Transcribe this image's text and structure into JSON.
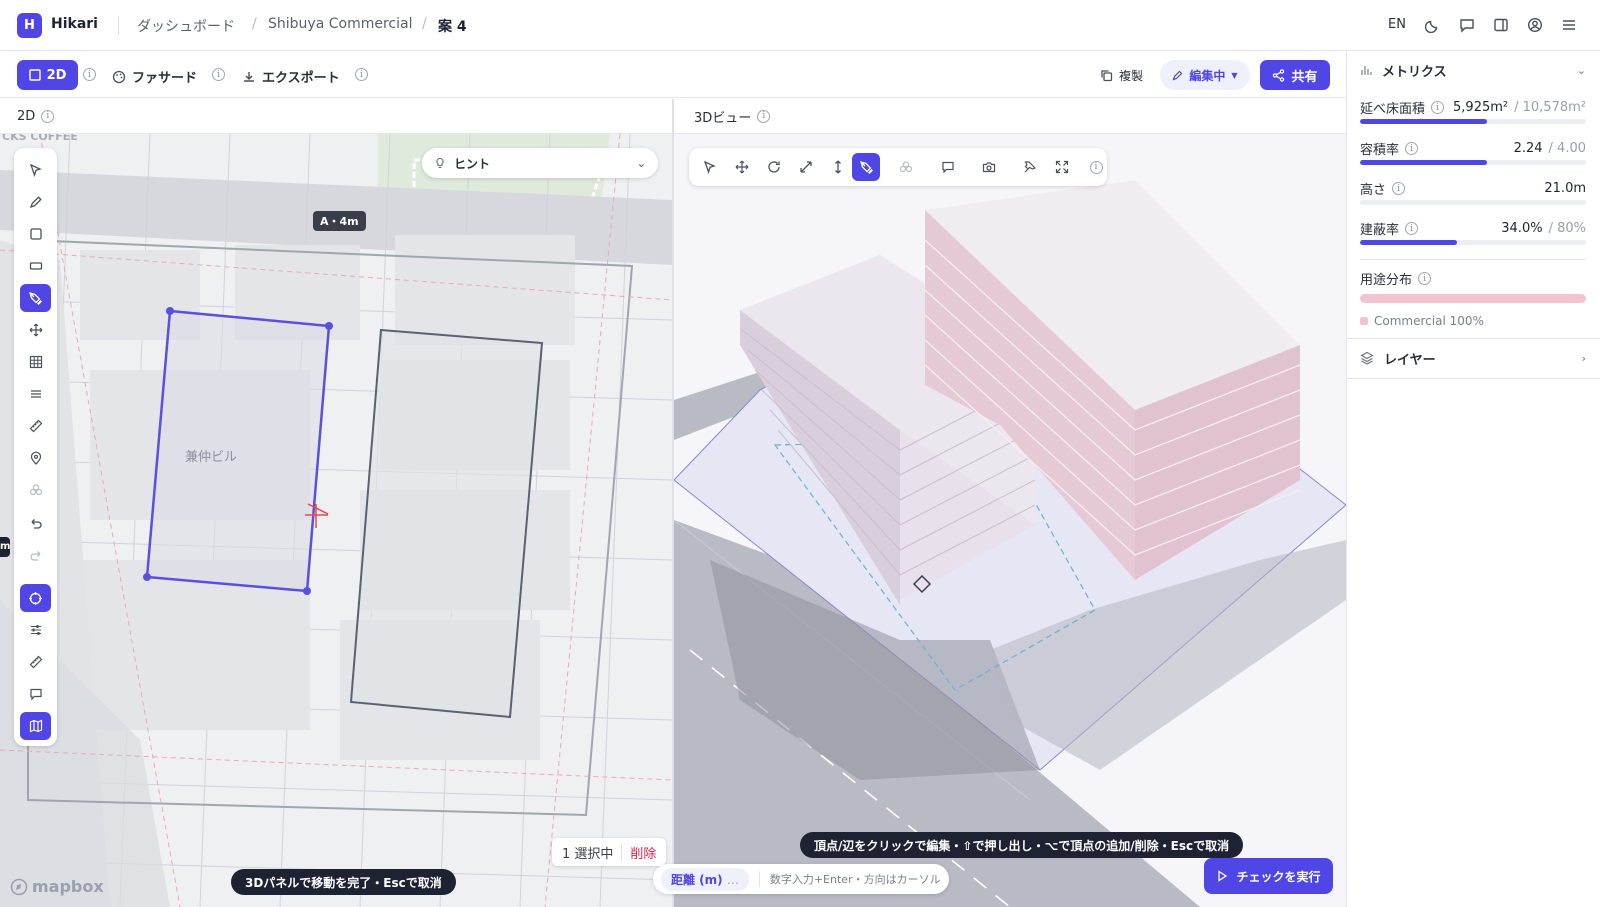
{
  "header": {
    "logo_letter": "H",
    "app_name": "Hikari",
    "breadcrumb": [
      "ダッシュボード",
      "Shibuya Commercial",
      "案 4"
    ],
    "lang": "EN"
  },
  "toolbar": {
    "mode_2d": "2D",
    "facade": "ファサード",
    "export": "エクスポート",
    "duplicate": "複製",
    "editing": "編集中",
    "share": "共有"
  },
  "panel_2d": {
    "title": "2D",
    "hint": "ヒント",
    "road_label": "A・4m",
    "building_label": "兼仲ビル",
    "shop_label": "CKS COFFEE",
    "selection_count": "1 選択中",
    "delete": "削除",
    "status": "3Dパネルで移動を完了・Escで取消",
    "mapbox": "mapbox"
  },
  "panel_3d": {
    "title": "3Dビュー",
    "instruction": "頂点/辺をクリックで編集・⇧で押し出し・⌥で頂点の追加/削除・Escで取消",
    "distance_label": "距離 (m)",
    "distance_ellipsis": "…",
    "distance_placeholder": "数字入力+Enter・方向はカーソル",
    "run_check": "チェックを実行"
  },
  "metrics": {
    "title": "メトリクス",
    "rows": [
      {
        "label": "延べ床面積",
        "value": "5,925m²",
        "limit": "/ 10,578m²",
        "fill": 0.56
      },
      {
        "label": "容積率",
        "value": "2.24",
        "limit": "/ 4.00",
        "fill": 0.56
      },
      {
        "label": "高さ",
        "value": "21.0m",
        "limit": "",
        "fill": 0
      },
      {
        "label": "建蔽率",
        "value": "34.0%",
        "limit": "/ 80%",
        "fill": 0.43
      }
    ],
    "usage_title": "用途分布",
    "usage_legend": "Commercial 100%",
    "usage_color": "#f2c4d2",
    "layers": "レイヤー"
  },
  "colors": {
    "accent": "#4f46e5",
    "danger": "#e11d48"
  }
}
